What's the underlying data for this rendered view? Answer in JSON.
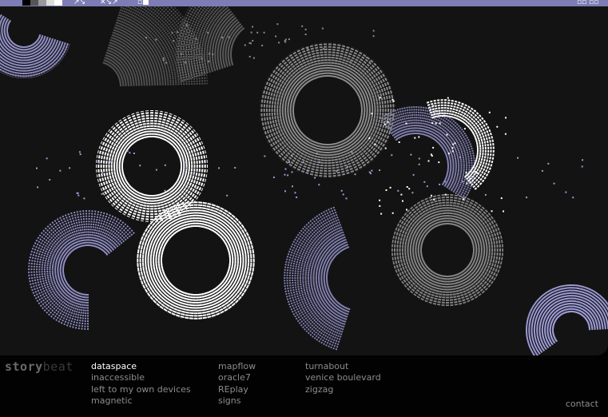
{
  "brand": {
    "part1": "story",
    "part2": "beat"
  },
  "nav": {
    "col1": [
      {
        "label": "dataspace",
        "active": true
      },
      {
        "label": "inaccessible"
      },
      {
        "label": "left to my own devices"
      },
      {
        "label": "magnetic"
      }
    ],
    "col2": [
      {
        "label": "mapflow"
      },
      {
        "label": "oracle7"
      },
      {
        "label": "REplay"
      },
      {
        "label": "signs"
      }
    ],
    "col3": [
      {
        "label": "turnabout"
      },
      {
        "label": "venice boulevard"
      },
      {
        "label": "zigzag"
      }
    ]
  },
  "contact_label": "contact",
  "colors": {
    "topbar": "#7d7cb4",
    "stage_bg": "#131313",
    "lavender": "#9c9ad6",
    "white": "#ffffff",
    "gray": "#8a8a8a",
    "nav_text": "#8c8c8c"
  },
  "icons": [
    "window-control-icon",
    "arrows-icon",
    "resize-icon",
    "grid-icon"
  ]
}
